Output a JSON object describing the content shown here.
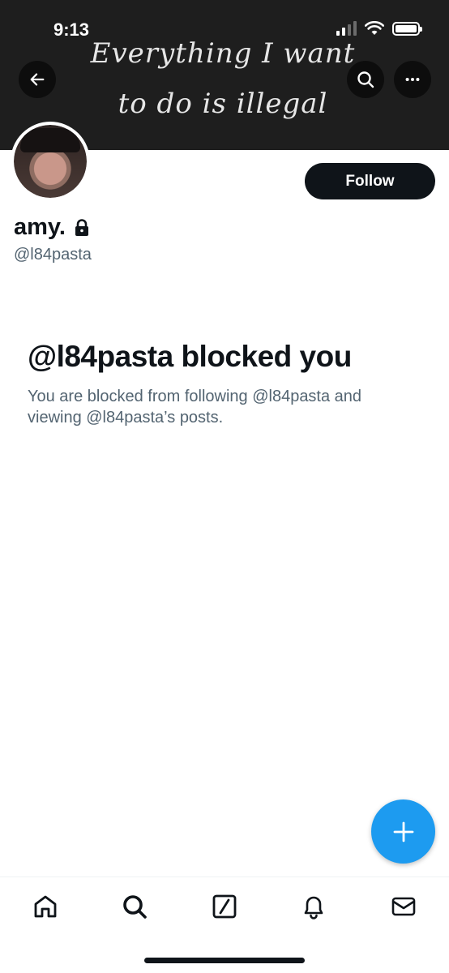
{
  "status_bar": {
    "time": "9:13",
    "icons": [
      "signal-icon",
      "wifi-icon",
      "battery-icon"
    ]
  },
  "header": {
    "banner_text_line1": "Everything I want",
    "banner_text_line2": "to do is illegal",
    "back_icon": "arrow-left-icon",
    "search_icon": "search-icon",
    "more_icon": "more-icon"
  },
  "profile": {
    "display_name": "amy.",
    "handle": "@l84pasta",
    "follow_label": "Follow",
    "protected_icon": "lock-icon"
  },
  "blocked": {
    "title": "@l84pasta blocked you",
    "description": "You are blocked from following @l84pasta and viewing @l84pasta’s posts."
  },
  "fab": {
    "icon": "plus-icon"
  },
  "tabbar": {
    "items": [
      "home-icon",
      "search-icon",
      "grok-icon",
      "bell-icon",
      "mail-icon"
    ]
  },
  "colors": {
    "accent": "#1d9bf0",
    "text_primary": "#0f1419",
    "text_secondary": "#536471",
    "banner_bg": "#1e1e1e"
  }
}
